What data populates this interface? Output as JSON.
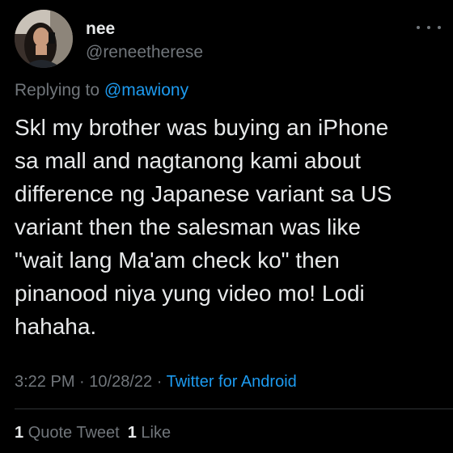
{
  "user": {
    "display_name": "nee",
    "handle": "@reneetherese"
  },
  "menu": {
    "icon": "more-horizontal-icon"
  },
  "reply": {
    "prefix": "Replying to",
    "mention": "@mawiony"
  },
  "tweet": {
    "lines": [
      "Skl my brother was buying an iPhone",
      "sa mall and nagtanong kami about",
      "difference ng Japanese variant sa US",
      "variant then the salesman was like",
      "\"wait lang Ma'am check ko\" then",
      "pinanood niya yung video mo! Lodi",
      "hahaha."
    ]
  },
  "meta": {
    "time": "3:22 PM",
    "separator": "·",
    "date": "10/28/22",
    "source": "Twitter for Android"
  },
  "stats": {
    "quote_tweets_count": "1",
    "quote_tweets_label": "Quote Tweet",
    "likes_count": "1",
    "likes_label": "Like"
  },
  "colors": {
    "background": "#000000",
    "text_primary": "#e7e9ea",
    "text_secondary": "#71767b",
    "accent": "#1d9bf0",
    "divider": "#2f3336"
  }
}
